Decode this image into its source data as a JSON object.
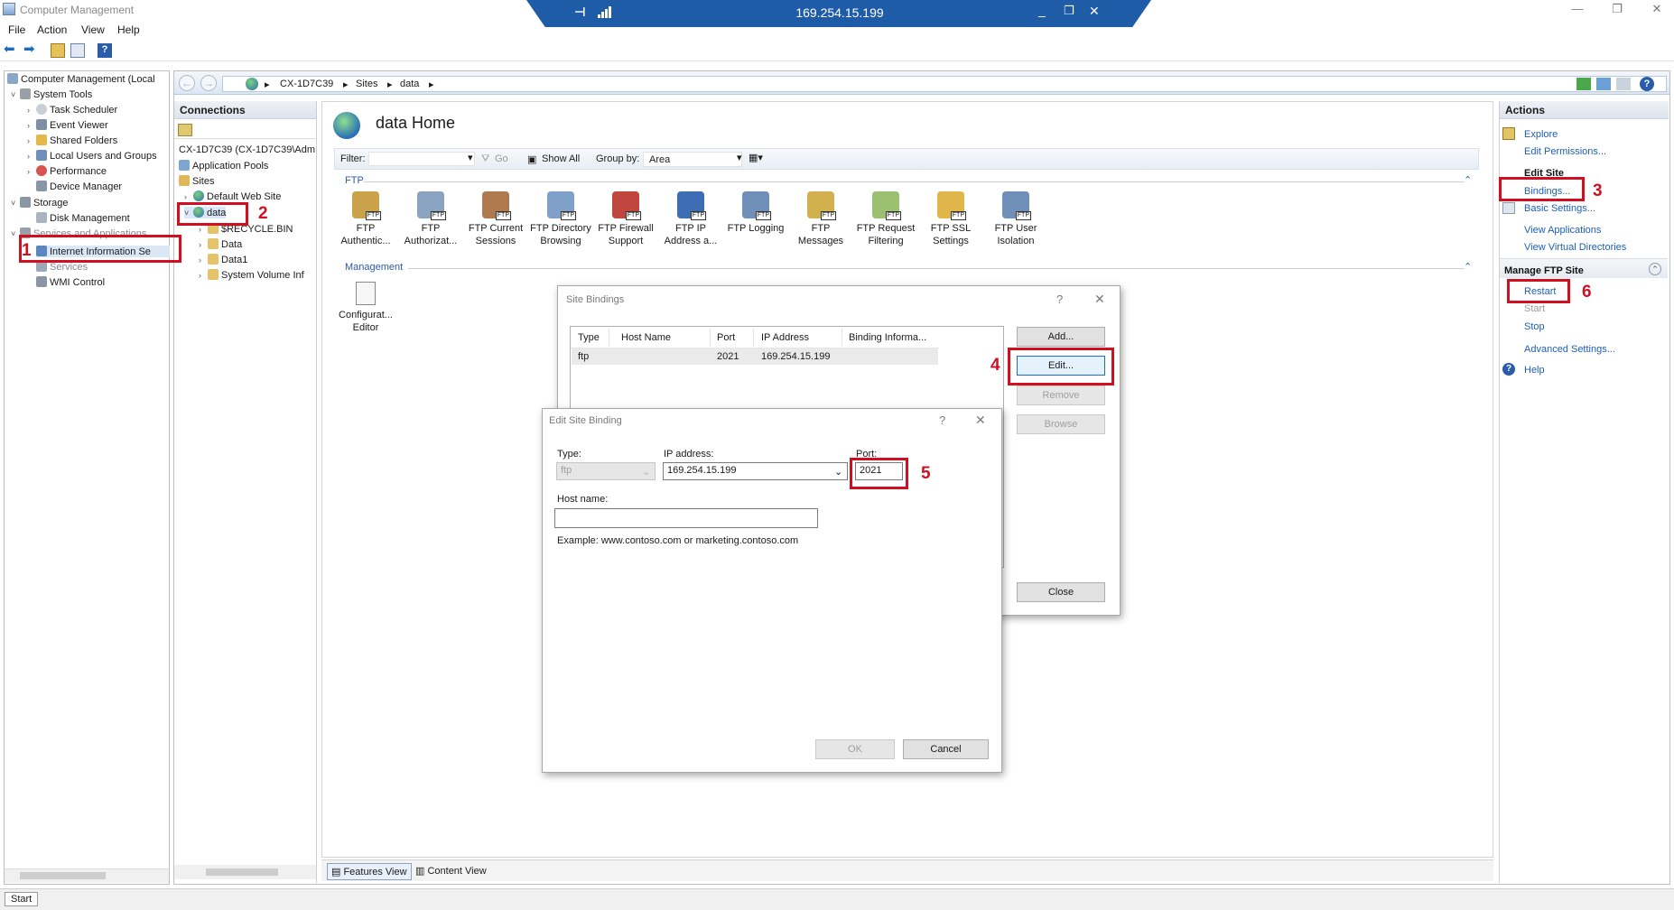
{
  "window": {
    "title": "Computer Management",
    "remote_ip": "169.254.15.199"
  },
  "menu": [
    "File",
    "Action",
    "View",
    "Help"
  ],
  "left_tree": {
    "root": "Computer Management (Local",
    "items": [
      {
        "label": "System Tools",
        "level": 1
      },
      {
        "label": "Task Scheduler",
        "level": 2
      },
      {
        "label": "Event Viewer",
        "level": 2
      },
      {
        "label": "Shared Folders",
        "level": 2
      },
      {
        "label": "Local Users and Groups",
        "level": 2
      },
      {
        "label": "Performance",
        "level": 2
      },
      {
        "label": "Device Manager",
        "level": 2
      },
      {
        "label": "Storage",
        "level": 1
      },
      {
        "label": "Disk Management",
        "level": 2
      },
      {
        "label": "Services and Applications",
        "level": 1
      },
      {
        "label": "Internet Information Se",
        "level": 2
      },
      {
        "label": "Services",
        "level": 2
      },
      {
        "label": "WMI Control",
        "level": 2
      }
    ]
  },
  "breadcrumb": [
    "CX-1D7C39",
    "Sites",
    "data"
  ],
  "connections": {
    "title": "Connections",
    "server": "CX-1D7C39 (CX-1D7C39\\Adm",
    "items": [
      {
        "label": "Application Pools",
        "level": 1
      },
      {
        "label": "Sites",
        "level": 1
      },
      {
        "label": "Default Web Site",
        "level": 2
      },
      {
        "label": "data",
        "level": 2
      },
      {
        "label": "$RECYCLE.BIN",
        "level": 3
      },
      {
        "label": "Data",
        "level": 3
      },
      {
        "label": "Data1",
        "level": 3
      },
      {
        "label": "System Volume Inf",
        "level": 3
      }
    ]
  },
  "home": {
    "title": "data Home",
    "filter_label": "Filter:",
    "go_label": "Go",
    "show_all_label": "Show All",
    "group_by_label": "Group by:",
    "group_by_value": "Area",
    "section_ftp": "FTP",
    "section_management": "Management",
    "ftp_features": [
      {
        "line1": "FTP",
        "line2": "Authentic..."
      },
      {
        "line1": "FTP",
        "line2": "Authorizat..."
      },
      {
        "line1": "FTP Current",
        "line2": "Sessions"
      },
      {
        "line1": "FTP Directory",
        "line2": "Browsing"
      },
      {
        "line1": "FTP Firewall",
        "line2": "Support"
      },
      {
        "line1": "FTP IP",
        "line2": "Address a..."
      },
      {
        "line1": "FTP Logging",
        "line2": ""
      },
      {
        "line1": "FTP",
        "line2": "Messages"
      },
      {
        "line1": "FTP Request",
        "line2": "Filtering"
      },
      {
        "line1": "FTP SSL",
        "line2": "Settings"
      },
      {
        "line1": "FTP User",
        "line2": "Isolation"
      }
    ],
    "mgmt_features": [
      {
        "line1": "Configurat...",
        "line2": "Editor"
      }
    ],
    "features_view": "Features View",
    "content_view": "Content View"
  },
  "actions": {
    "title": "Actions",
    "explore": "Explore",
    "edit_permissions": "Edit Permissions...",
    "edit_site_head": "Edit Site",
    "bindings": "Bindings...",
    "basic_settings": "Basic Settings...",
    "view_applications": "View Applications",
    "view_virtual_dirs": "View Virtual Directories",
    "manage_head": "Manage FTP Site",
    "restart": "Restart",
    "start": "Start",
    "stop": "Stop",
    "advanced_settings": "Advanced Settings...",
    "help": "Help"
  },
  "site_bindings": {
    "title": "Site Bindings",
    "help": "?",
    "columns": [
      "Type",
      "Host Name",
      "Port",
      "IP Address",
      "Binding Informa..."
    ],
    "rows": [
      {
        "type": "ftp",
        "host": "",
        "port": "2021",
        "ip": "169.254.15.199",
        "info": ""
      }
    ],
    "add": "Add...",
    "edit": "Edit...",
    "remove": "Remove",
    "browse": "Browse",
    "close": "Close"
  },
  "edit_binding": {
    "title": "Edit Site Binding",
    "help": "?",
    "type_label": "Type:",
    "type_value": "ftp",
    "ip_label": "IP address:",
    "ip_value": "169.254.15.199",
    "port_label": "Port:",
    "port_value": "2021",
    "host_label": "Host name:",
    "host_value": "",
    "example": "Example: www.contoso.com or marketing.contoso.com",
    "ok": "OK",
    "cancel": "Cancel"
  },
  "annotations": [
    "1",
    "2",
    "3",
    "4",
    "5",
    "6"
  ],
  "status": {
    "start": "Start"
  },
  "colors": {
    "accent": "#1f5ca8",
    "annotation": "#d01020",
    "link": "#1e5fb4"
  }
}
